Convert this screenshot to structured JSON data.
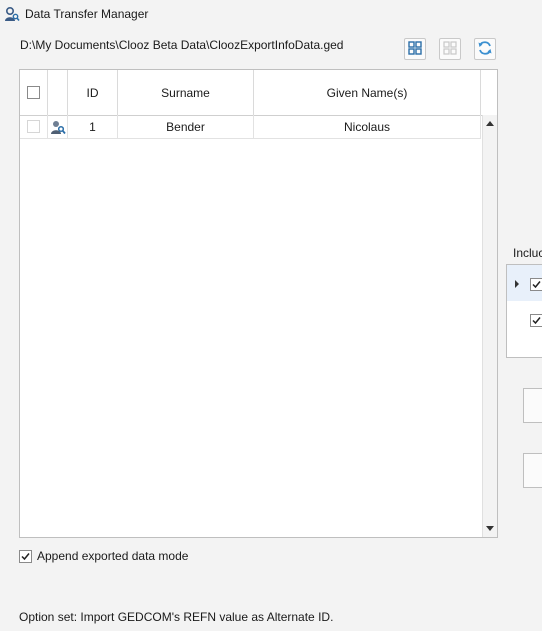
{
  "window": {
    "title": "Data Transfer Manager"
  },
  "file": {
    "path": "D:\\My Documents\\Clooz Beta Data\\CloozExportInfoData.ged"
  },
  "toolbar": {
    "icons": [
      "select-all-icon",
      "deselect-all-icon",
      "refresh-icon"
    ]
  },
  "table": {
    "columns": [
      "ID",
      "Surname",
      "Given Name(s)"
    ],
    "rows": [
      {
        "id": "1",
        "surname": "Bender",
        "given": "Nicolaus",
        "selected": false,
        "icon": "person-search-icon"
      }
    ]
  },
  "right_panel": {
    "include_label": "Incluc",
    "rows": [
      {
        "checked": true
      },
      {
        "checked": true
      }
    ]
  },
  "options": {
    "append_mode_label": "Append exported data mode",
    "append_mode_checked": true
  },
  "status": {
    "text": "Option set: Import GEDCOM's REFN value as Alternate ID."
  },
  "colors": {
    "accent": "#2b6ea8",
    "refresh": "#3a8fd0"
  }
}
